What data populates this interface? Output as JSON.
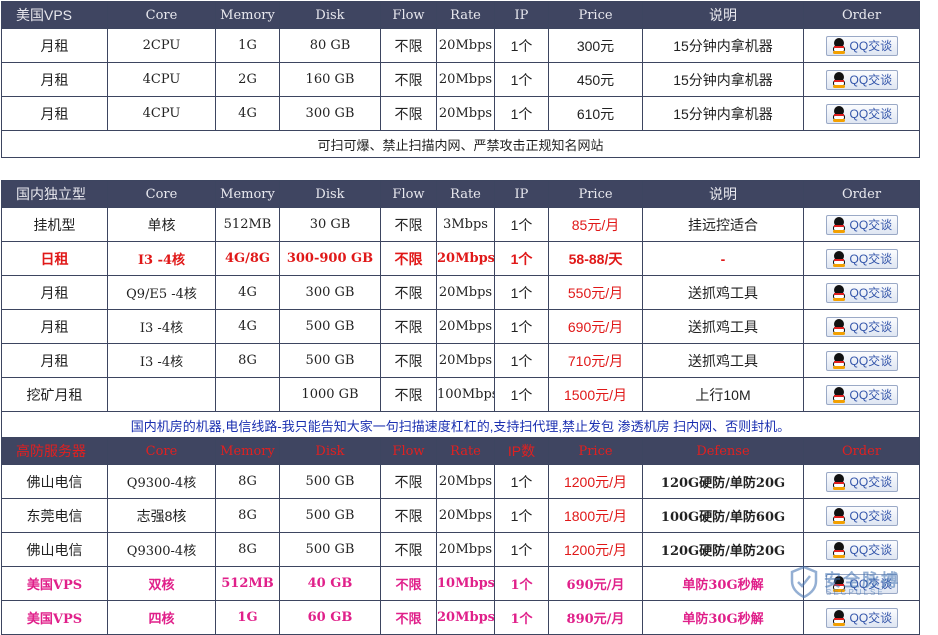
{
  "columns": [
    "Core",
    "Memory",
    "Disk",
    "Flow",
    "Rate",
    "IP",
    "Price",
    "说明",
    "Order"
  ],
  "order_label": "QQ交谈",
  "section1": {
    "title": "美国VPS",
    "rows": [
      [
        "月租",
        "2CPU",
        "1G",
        "80 GB",
        "不限",
        "20Mbps",
        "1个",
        "300元",
        "15分钟内拿机器"
      ],
      [
        "月租",
        "4CPU",
        "2G",
        "160 GB",
        "不限",
        "20Mbps",
        "1个",
        "450元",
        "15分钟内拿机器"
      ],
      [
        "月租",
        "4CPU",
        "4G",
        "300 GB",
        "不限",
        "20Mbps",
        "1个",
        "610元",
        "15分钟内拿机器"
      ]
    ],
    "note": "可扫可爆、禁止扫描内网、严禁攻击正规知名网站"
  },
  "section2": {
    "title": "国内独立型",
    "rows": [
      [
        "挂机型",
        "单核",
        "512MB",
        "30 GB",
        "不限",
        "3Mbps",
        "1个",
        "85元/月",
        "挂远控适合"
      ],
      [
        "日租",
        "I3 -4核",
        "4G/8G",
        "300-900 GB",
        "不限",
        "20Mbps",
        "1个",
        "58-88/天",
        "-"
      ],
      [
        "月租",
        "Q9/E5 -4核",
        "4G",
        "300 GB",
        "不限",
        "20Mbps",
        "1个",
        "550元/月",
        "送抓鸡工具"
      ],
      [
        "月租",
        "I3 -4核",
        "4G",
        "500 GB",
        "不限",
        "20Mbps",
        "1个",
        "690元/月",
        "送抓鸡工具"
      ],
      [
        "月租",
        "I3 -4核",
        "8G",
        "500 GB",
        "不限",
        "20Mbps",
        "1个",
        "710元/月",
        "送抓鸡工具"
      ],
      [
        "挖矿月租",
        "",
        "",
        "1000 GB",
        "不限",
        "100Mbps",
        "1个",
        "1500元/月",
        "上行10M"
      ]
    ],
    "note": "国内机房的机器,电信线路-我只能告知大家一句扫描速度杠杠的,支持扫代理,禁止发包 渗透机房 扫内网、否则封机。"
  },
  "section3": {
    "title": "高防服务器",
    "columns": [
      "Core",
      "Memory",
      "Disk",
      "Flow",
      "Rate",
      "IP数",
      "Price",
      "Defense",
      "Order"
    ],
    "rows": [
      [
        "佛山电信",
        "Q9300-4核",
        "8G",
        "500 GB",
        "不限",
        "20Mbps",
        "1个",
        "1200元/月",
        "120G硬防/单防20G"
      ],
      [
        "东莞电信",
        "志强8核",
        "8G",
        "500 GB",
        "不限",
        "20Mbps",
        "1个",
        "1800元/月",
        "100G硬防/单防60G"
      ],
      [
        "佛山电信",
        "Q9300-4核",
        "8G",
        "500 GB",
        "不限",
        "20Mbps",
        "1个",
        "1200元/月",
        "120G硬防/单防20G"
      ],
      [
        "美国VPS",
        "双核",
        "512MB",
        "40 GB",
        "不限",
        "10Mbps",
        "1个",
        "690元/月",
        "单防30G秒解"
      ],
      [
        "美国VPS",
        "四核",
        "1G",
        "60 GB",
        "不限",
        "20Mbps",
        "1个",
        "890元/月",
        "单防30G秒解"
      ]
    ]
  },
  "watermark": {
    "title": "安全脉搏",
    "subtitle": "SECPULSE"
  }
}
